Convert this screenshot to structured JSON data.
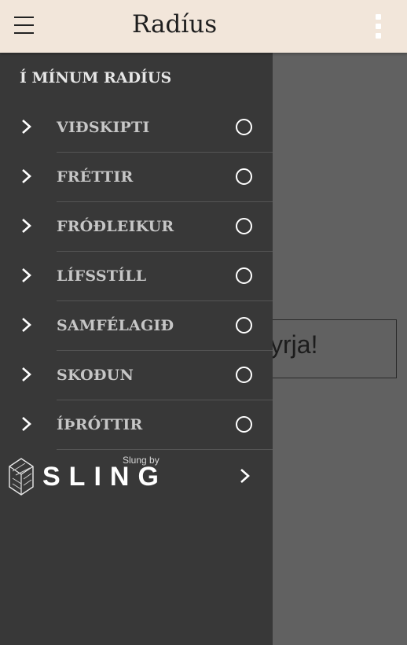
{
  "appbar": {
    "title": "Radíus"
  },
  "background": {
    "button_partial_text": "yrja!"
  },
  "drawer": {
    "header": "Í MÍNUM RADÍUS",
    "items": [
      {
        "label": "VIÐSKIPTI"
      },
      {
        "label": "FRÉTTIR"
      },
      {
        "label": "FRÓÐLEIKUR"
      },
      {
        "label": "LÍFSSTÍLL"
      },
      {
        "label": "SAMFÉLAGIÐ"
      },
      {
        "label": "SKOÐUN"
      },
      {
        "label": "ÍÞRÓTTIR"
      }
    ]
  },
  "footer": {
    "slung_by": "Slung by",
    "brand": "SLING"
  },
  "icons": {
    "menu": "hamburger-menu-icon",
    "overflow": "more-vertical-icon",
    "item_expand": "chevron-right-icon",
    "item_select": "radio-unchecked-icon",
    "brand_logo": "sling-cube-logo-icon"
  },
  "colors": {
    "appbar": "#f2e6da",
    "drawer": "#383838",
    "scrim": "#616161"
  }
}
